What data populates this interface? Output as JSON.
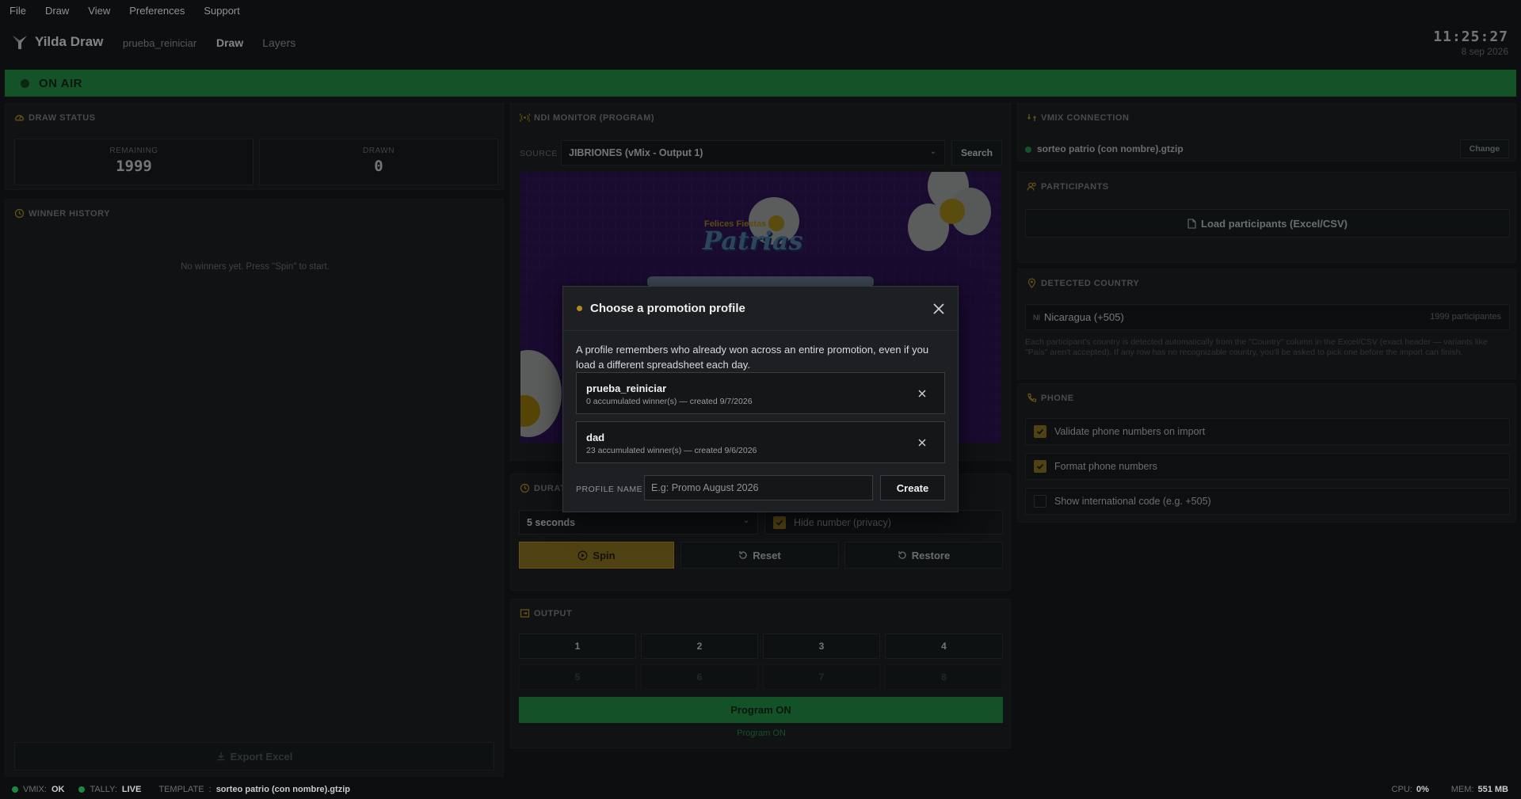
{
  "menu": [
    "File",
    "Draw",
    "View",
    "Preferences",
    "Support"
  ],
  "header": {
    "app_name": "Yilda Draw",
    "profile": "prueba_reiniciar",
    "tabs": {
      "draw": "Draw",
      "layers": "Layers"
    },
    "time": "11:25:27",
    "date": "8 sep 2026"
  },
  "onair": {
    "label": "ON AIR"
  },
  "draw_status": {
    "title": "Draw status",
    "remaining_label": "REMAINING",
    "remaining_value": "1999",
    "drawn_label": "DRAWN",
    "drawn_value": "0"
  },
  "winner_history": {
    "title": "Winner history",
    "empty": "No winners yet. Press \"Spin\" to start.",
    "export_label": "Export Excel"
  },
  "ndi": {
    "title": "NDI monitor (program)",
    "source_label": "SOURCE",
    "source_value": "JIBRIONES (vMix - Output 1)",
    "search_label": "Search",
    "preview_logo_top": "Felices Fiestas",
    "preview_logo_main": "Patrias"
  },
  "duration": {
    "title": "Durat",
    "select_value": "5 seconds",
    "hide_label": "Hide number (privacy)",
    "spin_label": "Spin",
    "reset_label": "Reset",
    "restore_label": "Restore"
  },
  "output": {
    "title": "Output",
    "buttons": [
      "1",
      "2",
      "3",
      "4",
      "5",
      "6",
      "7",
      "8"
    ],
    "program_button": "Program ON",
    "program_status": "Program ON"
  },
  "vmix": {
    "title": "vMix connection",
    "file": "sorteo patrio (con nombre).gtzip",
    "change_label": "Change"
  },
  "participants": {
    "title": "Participants",
    "load_label": "Load participants (Excel/CSV)"
  },
  "country": {
    "title": "Detected country",
    "code": "NI",
    "name": "Nicaragua (+505)",
    "count": "1999 participantes",
    "help": "Each participant's country is detected automatically from the \"Country\" column in the Excel/CSV (exact header — variants like \"País\" aren't accepted). If any row has no recognizable country, you'll be asked to pick one before the import can finish."
  },
  "phone": {
    "title": "Phone",
    "options": [
      {
        "label": "Validate phone numbers on import",
        "checked": true
      },
      {
        "label": "Format phone numbers",
        "checked": true
      },
      {
        "label": "Show international code (e.g. +505)",
        "checked": false
      }
    ]
  },
  "modal": {
    "title": "Choose a promotion profile",
    "description": "A profile remembers who already won across an entire promotion, even if you load a different spreadsheet each day.",
    "profiles": [
      {
        "name": "prueba_reiniciar",
        "meta": "0 accumulated winner(s) — created 9/7/2026"
      },
      {
        "name": "dad",
        "meta": "23 accumulated winner(s) — created 9/6/2026"
      }
    ],
    "name_label": "PROFILE NAME",
    "name_placeholder": "E.g: Promo August 2026",
    "create_label": "Create"
  },
  "statusbar": {
    "vmix_label": "VMIX:",
    "vmix_value": "OK",
    "tally_label": "TALLY:",
    "tally_value": "LIVE",
    "template_label": "TEMPLATE",
    "template_sep": ":",
    "template_value": "sorteo patrio (con nombre).gtzip",
    "cpu_label": "CPU:",
    "cpu_value": "0%",
    "mem_label": "MEM:",
    "mem_value": "551 MB"
  },
  "colors": {
    "accent": "#b08a1f",
    "onair": "#1b8a3c",
    "status_ok": "#1c8a3e",
    "background": "#0d0e0f"
  }
}
